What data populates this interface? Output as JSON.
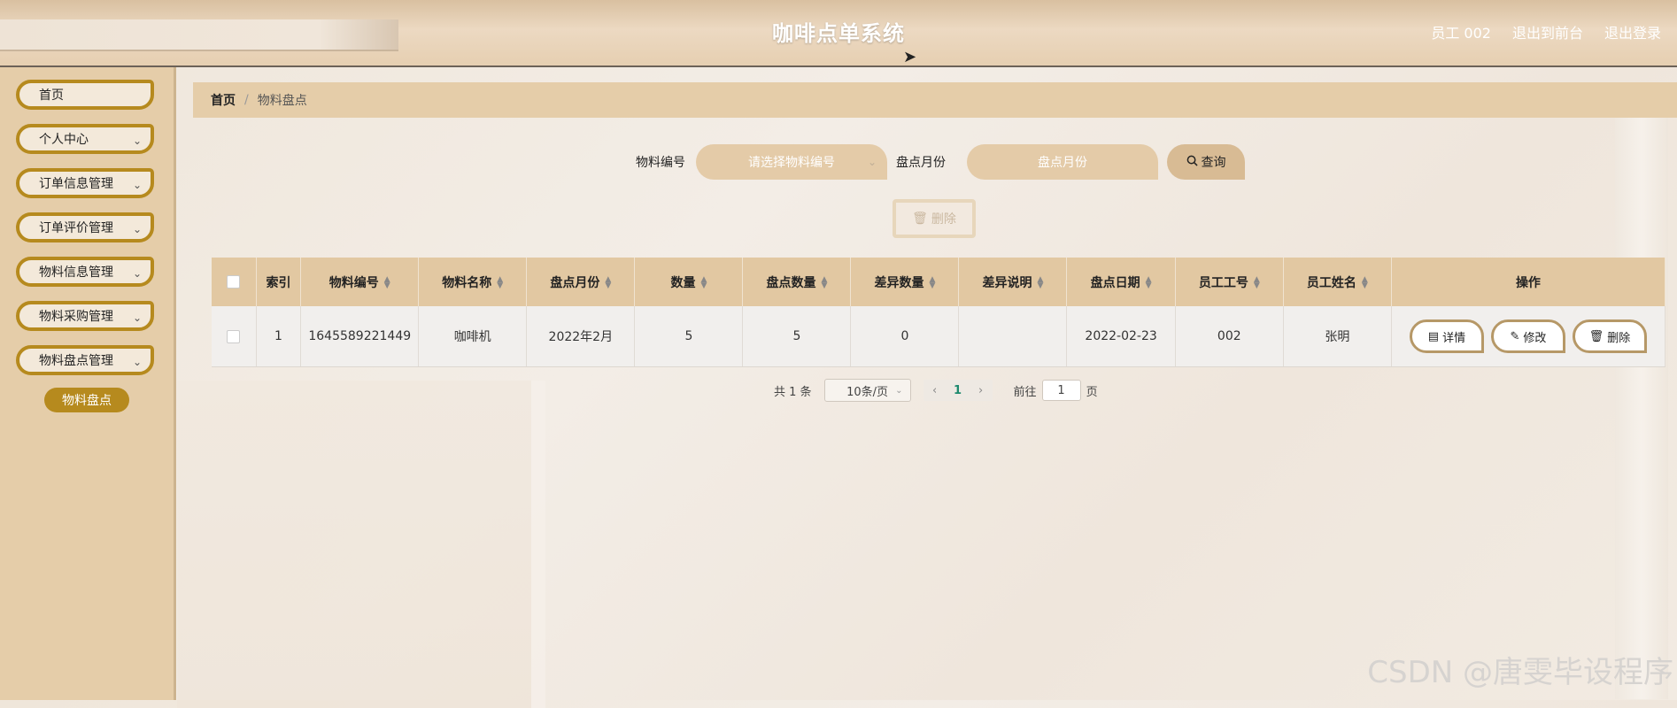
{
  "header": {
    "title": "咖啡点单系统",
    "user_label": "员工 002",
    "to_front": "退出到前台",
    "logout": "退出登录"
  },
  "sidebar": {
    "items": [
      {
        "label": "首页",
        "has_chevron": false
      },
      {
        "label": "个人中心",
        "has_chevron": true
      },
      {
        "label": "订单信息管理",
        "has_chevron": true
      },
      {
        "label": "订单评价管理",
        "has_chevron": true
      },
      {
        "label": "物料信息管理",
        "has_chevron": true
      },
      {
        "label": "物料采购管理",
        "has_chevron": true
      },
      {
        "label": "物料盘点管理",
        "has_chevron": true
      }
    ],
    "sub_item": "物料盘点",
    "chevron": "⌄"
  },
  "breadcrumb": {
    "home": "首页",
    "separator": "/",
    "current": "物料盘点"
  },
  "search": {
    "code_label": "物料编号",
    "code_placeholder": "请选择物料编号",
    "month_label": "盘点月份",
    "month_placeholder": "盘点月份",
    "query_button": "查询",
    "search_icon": "search-icon"
  },
  "toolbar": {
    "delete_button": "删除"
  },
  "table": {
    "headers": [
      "索引",
      "物料编号",
      "物料名称",
      "盘点月份",
      "数量",
      "盘点数量",
      "差异数量",
      "差异说明",
      "盘点日期",
      "员工工号",
      "员工姓名",
      "操作"
    ],
    "rows": [
      {
        "index": "1",
        "code": "1645589221449",
        "name": "咖啡机",
        "month": "2022年2月",
        "quantity": "5",
        "counted": "5",
        "diff": "0",
        "diff_note": "",
        "date": "2022-02-23",
        "emp_no": "002",
        "emp_name": "张明"
      }
    ],
    "actions": {
      "detail": "详情",
      "edit": "修改",
      "delete": "删除"
    }
  },
  "pagination": {
    "total": "共 1 条",
    "page_size": "10条/页",
    "current_page": "1",
    "goto_label": "前往",
    "goto_value": "1",
    "page_unit": "页"
  },
  "watermark": "CSDN @唐雯毕设程序"
}
